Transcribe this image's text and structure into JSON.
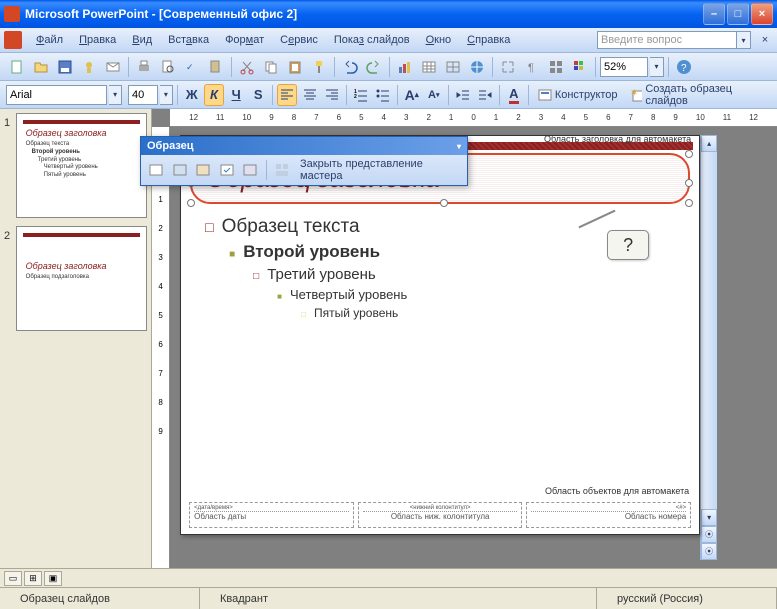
{
  "titlebar": {
    "app": "Microsoft PowerPoint",
    "doc": "[Современный офис 2]"
  },
  "menu": {
    "file": "Файл",
    "edit": "Правка",
    "view": "Вид",
    "insert": "Вставка",
    "format": "Формат",
    "tools": "Сервис",
    "slideshow": "Показ слайдов",
    "window": "Окно",
    "help": "Справка",
    "ask_placeholder": "Введите вопрос"
  },
  "toolbar": {
    "zoom": "52%"
  },
  "format_bar": {
    "font": "Arial",
    "size": "40",
    "designer": "Конструктор",
    "create_master": "Создать образец слайдов"
  },
  "master_toolbar": {
    "title": "Образец",
    "close": "Закрыть представление мастера"
  },
  "thumbs": {
    "n1": "1",
    "n2": "2",
    "t1_title": "Образец заголовка",
    "t1_l1": "Образец текста",
    "t1_l2": "Второй уровень",
    "t1_l3": "Третий уровень",
    "t1_l4": "Четвертый уровень",
    "t1_l5": "Пятый уровень",
    "t2_title": "Образец заголовка",
    "t2_sub": "Образец подзаголовка"
  },
  "ruler_h": [
    "12",
    "11",
    "10",
    "9",
    "8",
    "7",
    "6",
    "5",
    "4",
    "3",
    "2",
    "1",
    "0",
    "1",
    "2",
    "3",
    "4",
    "5",
    "6",
    "7",
    "8",
    "9",
    "10",
    "11",
    "12"
  ],
  "ruler_v": [
    "1",
    "0",
    "1",
    "2",
    "3",
    "4",
    "5",
    "6",
    "7",
    "8",
    "9"
  ],
  "slide": {
    "title_caption": "Область заголовка для автомакета",
    "title": "Образец заголовка",
    "l1": "Образец текста",
    "l2": "Второй уровень",
    "l3": "Третий уровень",
    "l4": "Четвертый уровень",
    "l5": "Пятый уровень",
    "body_caption": "Область объектов для автомакета",
    "callout": "?",
    "footer_date_top": "<дата/время>",
    "footer_date": "Область даты",
    "footer_mid_top": "<нижний колонтитул>",
    "footer_mid": "Область ниж. колонтитула",
    "footer_num_top": "<#>",
    "footer_num": "Область номера"
  },
  "status": {
    "left": "Образец слайдов",
    "mid": "Квадрант",
    "lang": "русский (Россия)"
  }
}
